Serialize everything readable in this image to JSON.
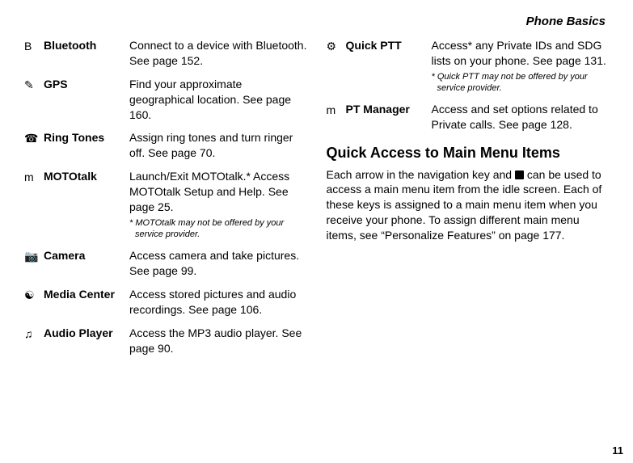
{
  "header": "Phone Basics",
  "left_entries": [
    {
      "icon": "B",
      "label": "Bluetooth",
      "desc": "Connect to a device with Bluetooth. See page 152.",
      "note": ""
    },
    {
      "icon": "✎",
      "label": "GPS",
      "desc": "Find your approximate geographical location. See page 160.",
      "note": ""
    },
    {
      "icon": "☎",
      "label": "Ring Tones",
      "desc": "Assign ring tones and turn ringer off. See page 70.",
      "note": ""
    },
    {
      "icon": "m",
      "label": "MOTOtalk",
      "desc": "Launch/Exit MOTOtalk.* Access MOTOtalk Setup and Help. See page 25.",
      "note": "* MOTOtalk may not be offered by your service provider."
    },
    {
      "icon": "📷",
      "label": "Camera",
      "desc": "Access camera and take pictures. See page 99.",
      "note": ""
    },
    {
      "icon": "☯",
      "label": "Media Center",
      "desc": "Access stored pictures and audio recordings. See page 106.",
      "note": ""
    },
    {
      "icon": "♫",
      "label": "Audio Player",
      "desc": "Access the MP3 audio player. See page 90.",
      "note": ""
    }
  ],
  "right_entries": [
    {
      "icon": "⚙",
      "label": "Quick PTT",
      "desc": "Access* any Private IDs and SDG lists on your phone. See page 131.",
      "note": "* Quick PTT may not be offered by your service provider."
    },
    {
      "icon": "m",
      "label": "PT Manager",
      "desc": "Access and set options related to Private calls. See page 128.",
      "note": ""
    }
  ],
  "section": {
    "title": "Quick Access to Main Menu Items",
    "body_prefix": "Each arrow in the navigation key and ",
    "body_suffix": " can be used to access a main menu item from the idle screen. Each of these keys is assigned to a main menu item when you receive your phone. To assign different main menu items, see “Personalize Features” on page 177."
  },
  "page_number": "11"
}
